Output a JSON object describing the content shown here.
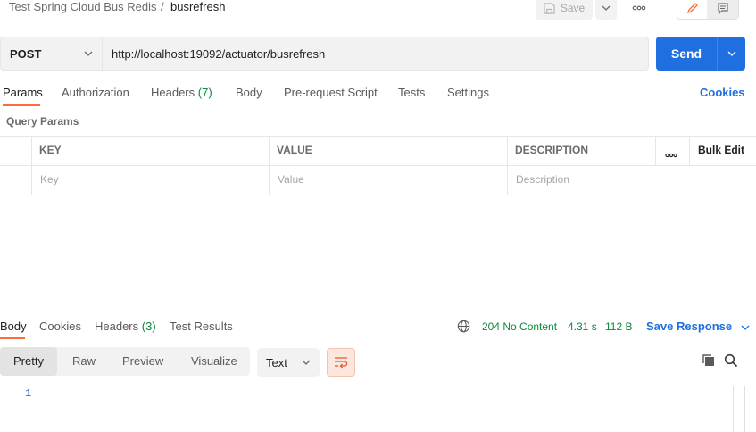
{
  "breadcrumb": {
    "parent": "Test Spring Cloud Bus Redis",
    "separator": "/",
    "current": "busrefresh"
  },
  "toolbar": {
    "save_label": "Save",
    "save_icon": "save-icon",
    "more_icon": "more-horizontal-icon",
    "edit_icon": "pencil-icon",
    "doc_icon": "comment-icon"
  },
  "request": {
    "method": "POST",
    "url": "http://localhost:19092/actuator/busrefresh",
    "send_label": "Send"
  },
  "request_tabs": [
    {
      "label": "Params",
      "active": true
    },
    {
      "label": "Authorization"
    },
    {
      "label": "Headers",
      "badge": "(7)"
    },
    {
      "label": "Body"
    },
    {
      "label": "Pre-request Script"
    },
    {
      "label": "Tests"
    },
    {
      "label": "Settings"
    }
  ],
  "cookies_label": "Cookies",
  "query_params": {
    "title": "Query Params",
    "columns": [
      "KEY",
      "VALUE",
      "DESCRIPTION"
    ],
    "bulk_edit": "Bulk Edit",
    "placeholders": {
      "key": "Key",
      "value": "Value",
      "description": "Description"
    }
  },
  "response": {
    "tabs": [
      {
        "label": "Body",
        "active": true
      },
      {
        "label": "Cookies"
      },
      {
        "label": "Headers",
        "badge": "(3)"
      },
      {
        "label": "Test Results"
      }
    ],
    "status": "204 No Content",
    "time": "4.31 s",
    "size": "112 B",
    "save_response": "Save Response",
    "format_options": [
      "Pretty",
      "Raw",
      "Preview",
      "Visualize"
    ],
    "active_format": "Pretty",
    "language": "Text",
    "line_numbers": [
      "1"
    ]
  },
  "colors": {
    "accent": "#ff6c37",
    "primary": "#1f6fe0",
    "success": "#0b8a3a"
  }
}
